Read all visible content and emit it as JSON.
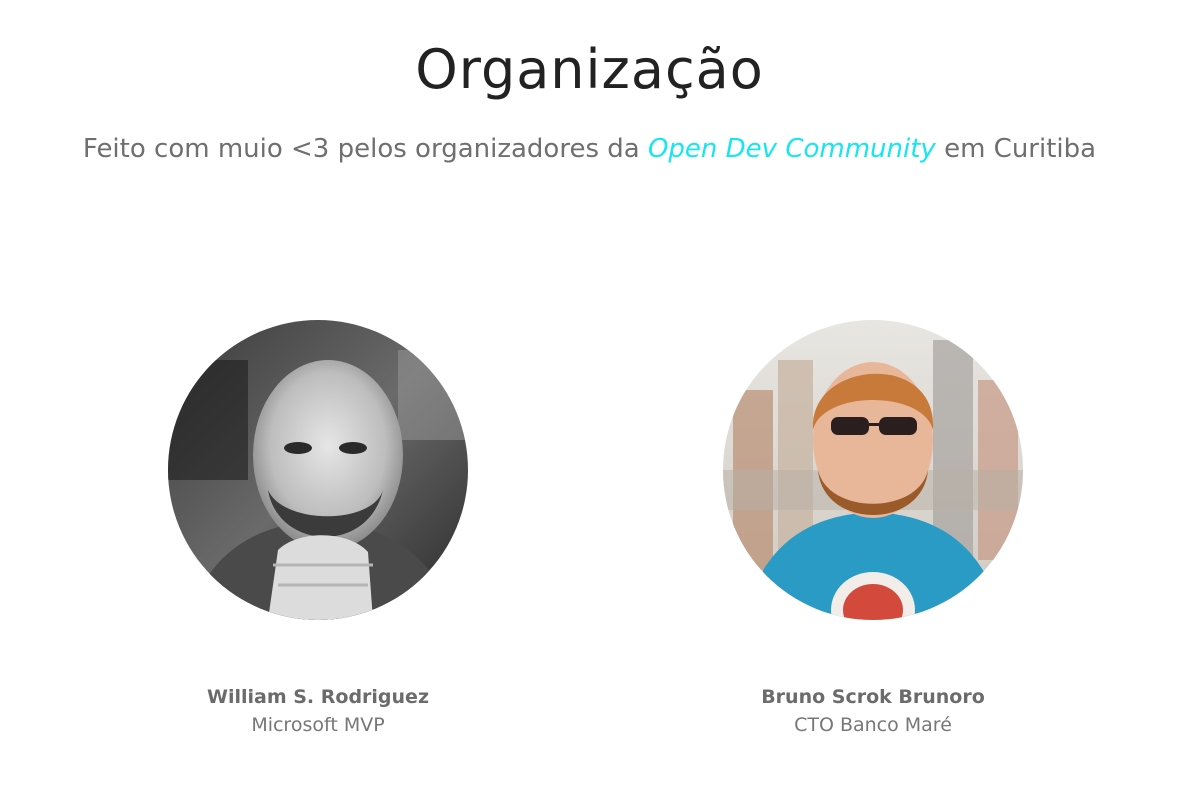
{
  "section": {
    "title": "Organização",
    "subtitle_prefix": "Feito com muio <3 pelos organizadores da ",
    "subtitle_link": "Open Dev Community",
    "subtitle_suffix": " em Curitiba"
  },
  "organizers": [
    {
      "name": "William S. Rodriguez",
      "role": "Microsoft MVP"
    },
    {
      "name": "Bruno Scrok Brunoro",
      "role": "CTO Banco Maré"
    }
  ],
  "colors": {
    "accent": "#16e6ef",
    "title": "#222222",
    "text": "#6f6f6f"
  }
}
